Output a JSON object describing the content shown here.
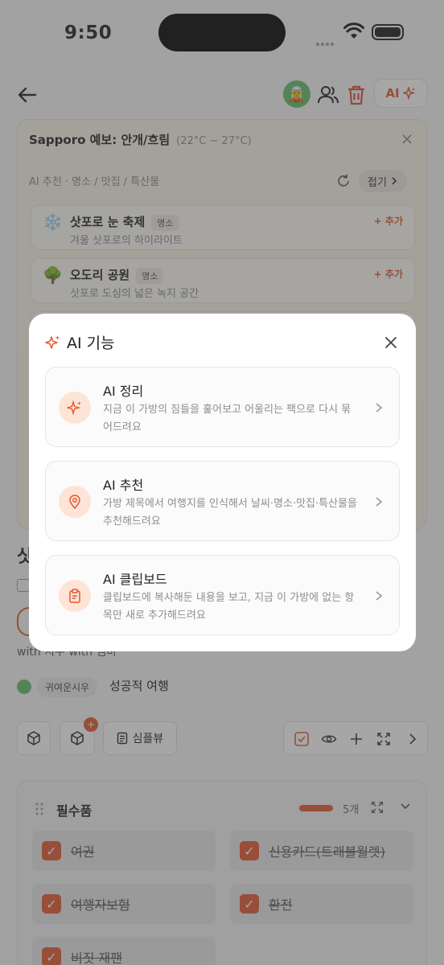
{
  "status": {
    "time": "9:50"
  },
  "header": {
    "ai_label": "AI",
    "avatar_emoji": "🧝"
  },
  "forecast": {
    "text": "Sapporo 예보: 안개/흐림",
    "temp": "(22°C ~ 27°C)"
  },
  "recommend": {
    "header": "AI 추천 · 명소 / 맛집 / 특산물",
    "fold_label": "접기",
    "items": [
      {
        "emoji": "❄️",
        "name": "삿포로 눈 축제",
        "tag": "명소",
        "desc": "겨울 삿포로의 하이라이트",
        "add": "+ 추가"
      },
      {
        "emoji": "🌳",
        "name": "오도리 공원",
        "tag": "명소",
        "desc": "삿포로 도심의 넓은 녹지 공간",
        "add": "+ 추가"
      }
    ]
  },
  "bag": {
    "title": "삿",
    "with_text": "with 지우 with 엄마",
    "member_avatar": "🧝",
    "member": "귀여운시우",
    "trip_name": "성공적 여행",
    "badge_count": "+",
    "simple_view": "심플뷰"
  },
  "essentials": {
    "title": "필수품",
    "count": "5개",
    "items": [
      "여권",
      "신용카드(트래블월렛)",
      "여행자보험",
      "환전",
      "비짓 재팬"
    ]
  },
  "modal": {
    "title": "AI 기능",
    "options": [
      {
        "title": "AI 정리",
        "desc": "지금 이 가방의 짐들을 훑어보고 어울리는 팩으로 다시 묶어드려요"
      },
      {
        "title": "AI 추천",
        "desc": "가방 제목에서 여행지를 인식해서 날씨·명소·맛집·특산물을 추천해드려요"
      },
      {
        "title": "AI 클립보드",
        "desc": "클립보드에 복사해둔 내용을 보고, 지금 이 가방에 없는 항목만 새로 추가해드려요"
      }
    ]
  }
}
